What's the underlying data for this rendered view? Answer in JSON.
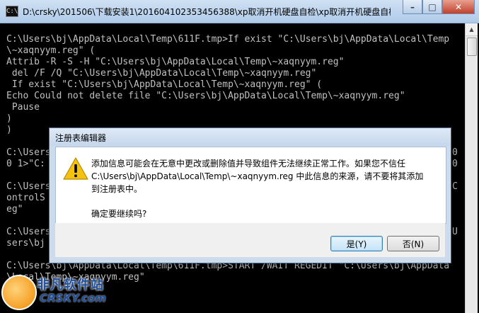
{
  "console": {
    "title": "D:\\crsky\\201506\\下载安装1\\201604102353456388\\xp取消开机硬盘自检\\xp取消开机硬盘自检....",
    "lines": [
      "C:\\Users\\bj\\AppData\\Local\\Temp\\611F.tmp>If exist \"C:\\Users\\bj\\AppData\\Local\\Temp",
      "\\~xaqnyym.reg\" (",
      "Attrib -R -S -H \"C:\\Users\\bj\\AppData\\Local\\Temp\\~xaqnyym.reg\"",
      " del /F /Q \"C:\\Users\\bj\\AppData\\Local\\Temp\\~xaqnyym.reg\"",
      " If exist \"C:\\Users\\bj\\AppData\\Local\\Temp\\~xaqnyym.reg\" (",
      "Echo Could not delete file \"C:\\Users\\bj\\AppData\\Local\\Temp\\~xaqnyym.reg\"",
      " Pause",
      ")",
      ")",
      "",
      "C:\\Users",
      "0 1>\"C:",
      "",
      "C:\\Users",
      "ontrolS",
      "eg\"",
      "",
      "C:\\Users",
      "sers\\bj",
      "",
      "",
      "C:\\Users\\bj\\AppData\\Local\\Temp\\611F.tmp>START /WAIT REGEDIT \"C:\\Users\\bj\\AppData",
      "\\Local\\Temp\\~xaqnyym.reg\""
    ],
    "right_fragments": [
      "0",
      "0",
      "C",
      "U"
    ]
  },
  "dialog": {
    "title": "注册表编辑器",
    "message": "添加信息可能会在无意中更改或删除值并导致组件无法继续正常工作。如果您不信任 C:\\Users\\bj\\AppData\\Local\\Temp\\~xaqnyym.reg 中此信息的来源，请不要将其添加到注册表中。",
    "question": "确定要继续吗?",
    "yes_label": "是(Y)",
    "no_label": "否(N)",
    "icon": "warning-icon"
  },
  "watermark": {
    "text_cn": "非凡软件站",
    "text_en": "CRSKY.com"
  },
  "colors": {
    "console_bg": "#000000",
    "console_fg": "#c0c0c0",
    "dialog_frame": "#ccdcec",
    "warning": "#f5c211"
  }
}
